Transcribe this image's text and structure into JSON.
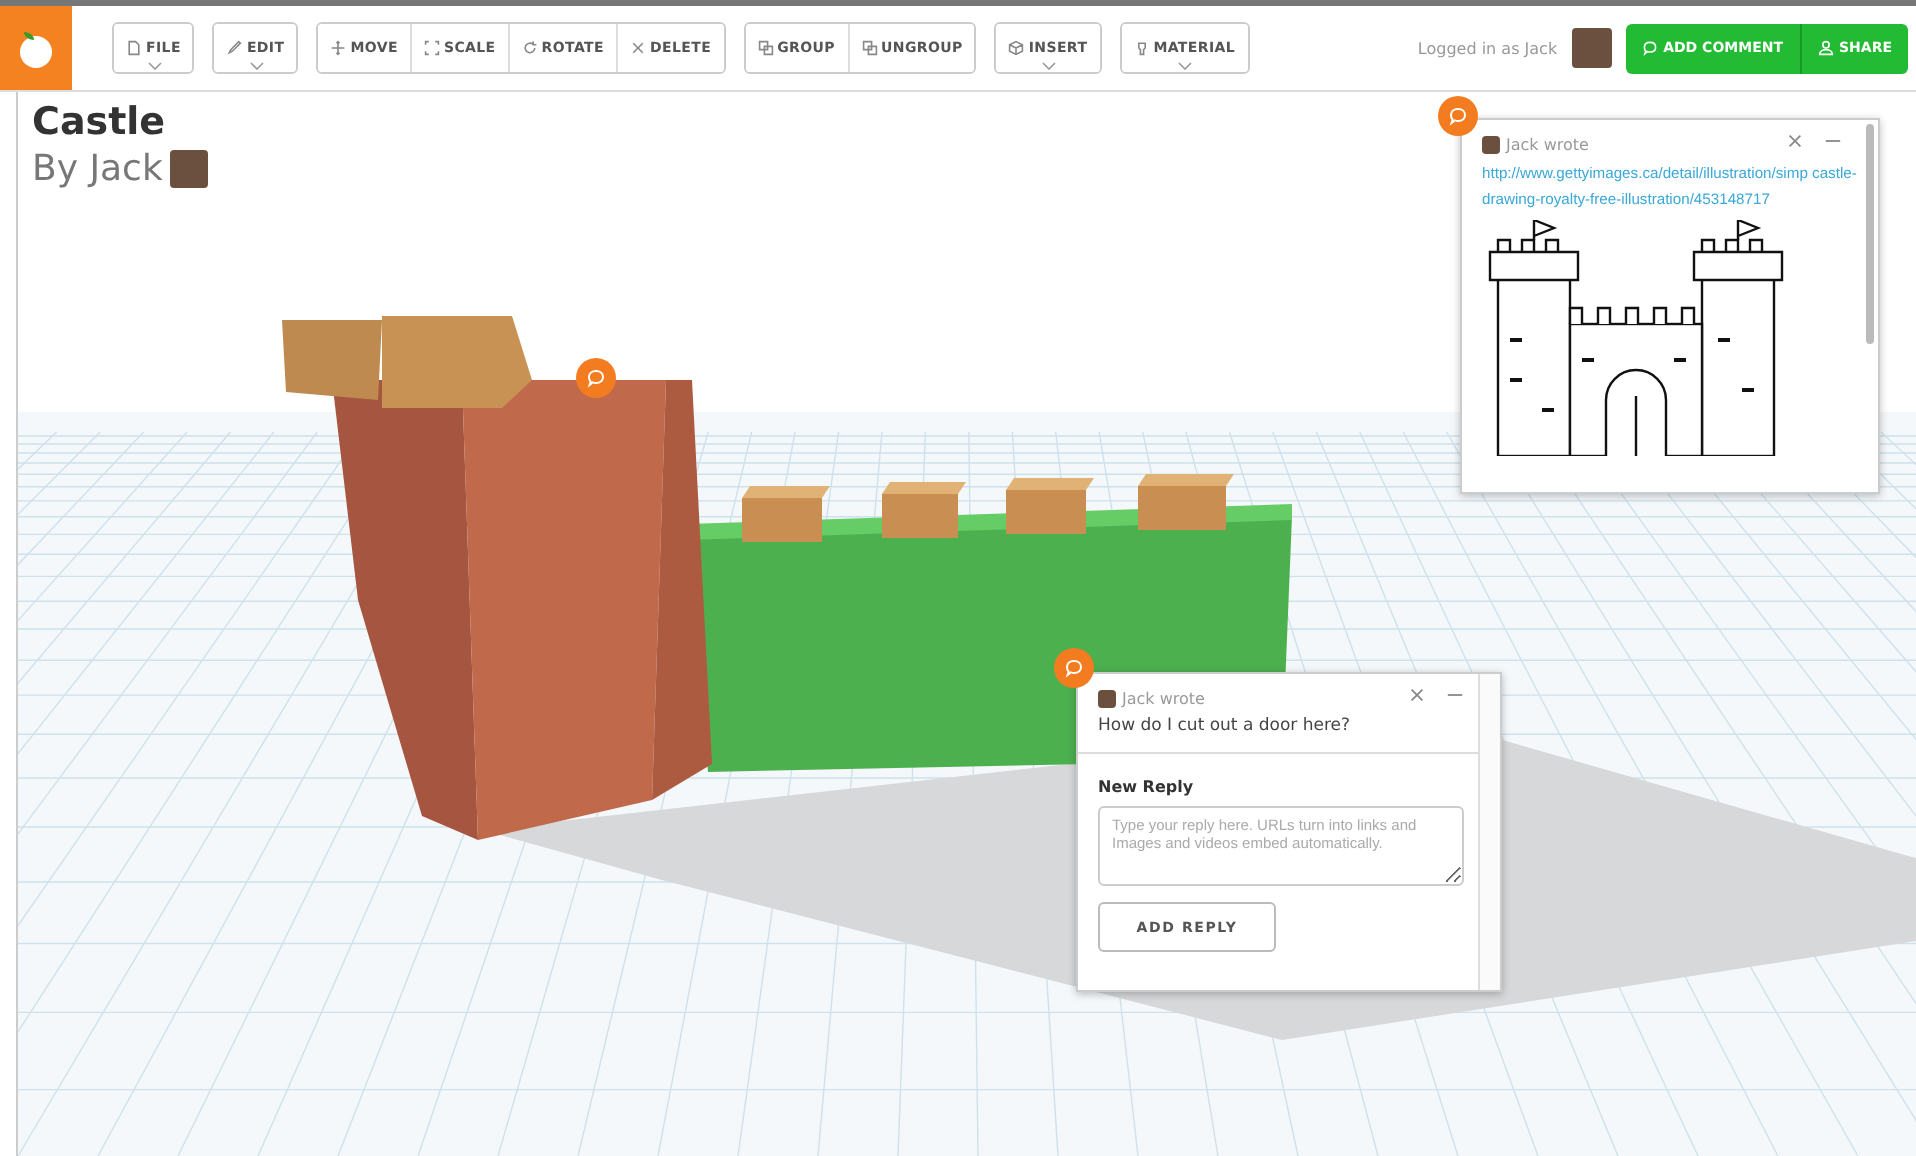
{
  "toolbar": {
    "groups": [
      [
        {
          "label": "FILE",
          "dropdown": true
        }
      ],
      [
        {
          "label": "EDIT",
          "dropdown": true
        }
      ],
      [
        {
          "label": "MOVE",
          "dropdown": false
        },
        {
          "label": "SCALE",
          "dropdown": false
        },
        {
          "label": "ROTATE",
          "dropdown": false
        },
        {
          "label": "DELETE",
          "dropdown": false
        }
      ],
      [
        {
          "label": "GROUP",
          "dropdown": false
        },
        {
          "label": "UNGROUP",
          "dropdown": false
        }
      ],
      [
        {
          "label": "INSERT",
          "dropdown": true
        }
      ],
      [
        {
          "label": "MATERIAL",
          "dropdown": true
        }
      ]
    ]
  },
  "user": {
    "logged_in": "Logged in as Jack",
    "add_comment": "ADD COMMENT",
    "share": "SHARE"
  },
  "model": {
    "title": "Castle",
    "byline": "By Jack"
  },
  "comments": [
    {
      "author": "Jack wrote",
      "link": "http://www.gettyimages.ca/detail/illustration/simp castle-drawing-royalty-free-illustration/453148717"
    },
    {
      "author": "Jack wrote",
      "text": "How do I cut out a door here?",
      "reply_label": "New Reply",
      "placeholder": "Type your reply here. URLs turn into links and Images and videos embed automatically.",
      "reply_button": "ADD REPLY"
    }
  ]
}
